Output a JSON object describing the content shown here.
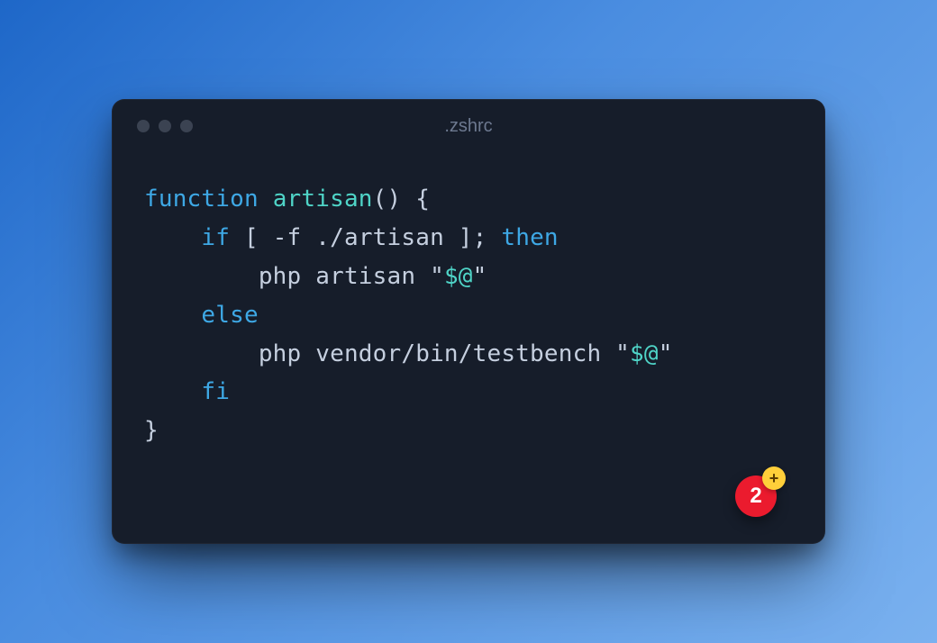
{
  "window": {
    "title": ".zshrc"
  },
  "code": {
    "lines": [
      {
        "tokens": [
          {
            "cls": "kw",
            "t": "function"
          },
          {
            "cls": "pc",
            "t": " "
          },
          {
            "cls": "fn",
            "t": "artisan"
          },
          {
            "cls": "pc",
            "t": "() {"
          }
        ]
      },
      {
        "tokens": [
          {
            "cls": "pc",
            "t": "    "
          },
          {
            "cls": "kw",
            "t": "if"
          },
          {
            "cls": "pc",
            "t": " [ -f ./artisan ]; "
          },
          {
            "cls": "kw",
            "t": "then"
          }
        ]
      },
      {
        "tokens": [
          {
            "cls": "pc",
            "t": "        php artisan "
          },
          {
            "cls": "str",
            "t": "\""
          },
          {
            "cls": "var",
            "t": "$@"
          },
          {
            "cls": "str",
            "t": "\""
          }
        ]
      },
      {
        "tokens": [
          {
            "cls": "pc",
            "t": "    "
          },
          {
            "cls": "kw",
            "t": "else"
          }
        ]
      },
      {
        "tokens": [
          {
            "cls": "pc",
            "t": "        php vendor/bin/testbench "
          },
          {
            "cls": "str",
            "t": "\""
          },
          {
            "cls": "var",
            "t": "$@"
          },
          {
            "cls": "str",
            "t": "\""
          }
        ]
      },
      {
        "tokens": [
          {
            "cls": "pc",
            "t": "    "
          },
          {
            "cls": "kw",
            "t": "fi"
          }
        ]
      },
      {
        "tokens": [
          {
            "cls": "pc",
            "t": "}"
          }
        ]
      }
    ]
  },
  "badge": {
    "count": "2",
    "plus": "+"
  }
}
